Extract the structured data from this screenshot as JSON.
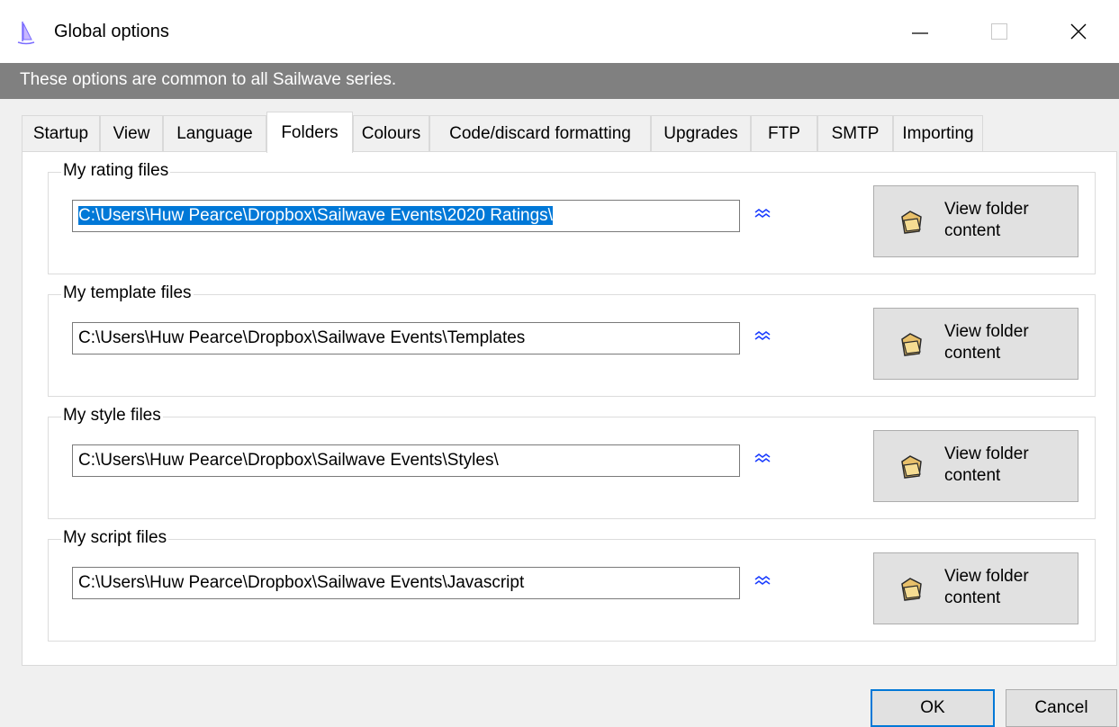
{
  "window": {
    "title": "Global options",
    "minimize_icon": "minimize-icon",
    "maximize_icon": "maximize-icon",
    "close_icon": "close-icon"
  },
  "banner": {
    "text": "These options are common to all Sailwave series."
  },
  "tabs": [
    {
      "label": "Startup"
    },
    {
      "label": "View"
    },
    {
      "label": "Language"
    },
    {
      "label": "Folders",
      "active": true
    },
    {
      "label": "Colours"
    },
    {
      "label": "Code/discard formatting"
    },
    {
      "label": "Upgrades"
    },
    {
      "label": "FTP"
    },
    {
      "label": "SMTP"
    },
    {
      "label": "Importing"
    }
  ],
  "folders": [
    {
      "legend": "My rating files",
      "path": "C:\\Users\\Huw Pearce\\Dropbox\\Sailwave Events\\2020 Ratings\\",
      "selected": true,
      "button": [
        "View folder",
        "content"
      ]
    },
    {
      "legend": "My template files",
      "path": "C:\\Users\\Huw Pearce\\Dropbox\\Sailwave Events\\Templates",
      "button": [
        "View folder",
        "content"
      ]
    },
    {
      "legend": "My style files",
      "path": "C:\\Users\\Huw Pearce\\Dropbox\\Sailwave Events\\Styles\\",
      "button": [
        "View folder",
        "content"
      ]
    },
    {
      "legend": "My script files",
      "path": "C:\\Users\\Huw Pearce\\Dropbox\\Sailwave Events\\Javascript",
      "button": [
        "View folder",
        "content"
      ]
    }
  ],
  "footer": {
    "ok_label": "OK",
    "cancel_label": "Cancel"
  },
  "colors": {
    "banner": "#808080",
    "selection": "#0078d7",
    "browse_icon": "#1a3cff"
  }
}
